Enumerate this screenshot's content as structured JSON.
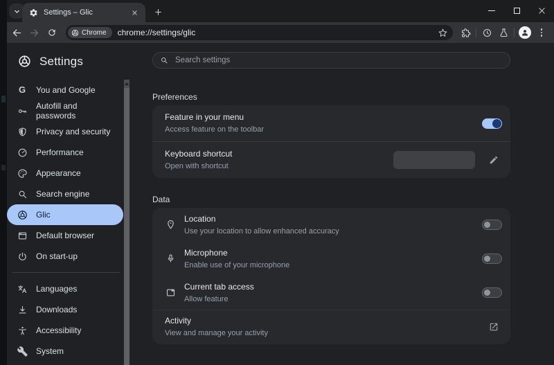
{
  "browser": {
    "tab": {
      "title": "Settings – Glic",
      "favicon": "gear-icon"
    },
    "toolbar_icons": [
      "back-icon",
      "forward-icon",
      "reload-icon",
      "star-icon",
      "extensions-puzzle-icon",
      "history-icon",
      "labs-beaker-icon",
      "profile-avatar",
      "kebab-menu-icon"
    ],
    "window_controls": [
      "minimize",
      "maximize",
      "close"
    ],
    "address": {
      "chip_label": "Chrome",
      "chip_icon": "chrome-logo",
      "url": "chrome://settings/glic"
    }
  },
  "sidebar": {
    "title": "Settings",
    "logo_icon": "chrome-logo",
    "items": [
      {
        "label": "You and Google",
        "icon": "google-g-icon",
        "glyph": "G",
        "selected": false
      },
      {
        "label": "Autofill and passwords",
        "icon": "key-icon",
        "selected": false
      },
      {
        "label": "Privacy and security",
        "icon": "shield-icon",
        "selected": false
      },
      {
        "label": "Performance",
        "icon": "speedometer-icon",
        "selected": false
      },
      {
        "label": "Appearance",
        "icon": "palette-icon",
        "selected": false
      },
      {
        "label": "Search engine",
        "icon": "magnifier-icon",
        "selected": false
      },
      {
        "label": "Glic",
        "icon": "chrome-logo-icon",
        "selected": true
      },
      {
        "label": "Default browser",
        "icon": "browser-window-icon",
        "selected": false
      },
      {
        "label": "On start-up",
        "icon": "power-icon",
        "selected": false
      },
      {
        "label": "Languages",
        "icon": "translate-icon",
        "selected": false
      },
      {
        "label": "Downloads",
        "icon": "download-icon",
        "selected": false
      },
      {
        "label": "Accessibility",
        "icon": "accessibility-person-icon",
        "selected": false
      },
      {
        "label": "System",
        "icon": "wrench-icon",
        "selected": false
      }
    ]
  },
  "search": {
    "placeholder": "Search settings",
    "icon": "magnifier-icon"
  },
  "sections": {
    "preferences": {
      "label": "Preferences",
      "rows": [
        {
          "title": "Feature in your menu",
          "subtitle": "Access feature on the toolbar",
          "control": "toggle",
          "state": "on"
        },
        {
          "title": "Keyboard shortcut",
          "subtitle": "Open with shortcut",
          "control": "shortcut-input",
          "value": "",
          "edit_icon": "pencil-icon"
        }
      ]
    },
    "data": {
      "label": "Data",
      "rows": [
        {
          "icon": "location-pin-icon",
          "title": "Location",
          "subtitle": "Use your location to allow enhanced accuracy",
          "control": "toggle",
          "state": "off"
        },
        {
          "icon": "microphone-icon",
          "title": "Microphone",
          "subtitle": "Enable use of your microphone",
          "control": "toggle",
          "state": "off"
        },
        {
          "icon": "browser-tab-icon",
          "title": "Current tab access",
          "subtitle": "Allow feature",
          "control": "toggle",
          "state": "off"
        },
        {
          "title": "Activity",
          "subtitle": "View and manage your activity",
          "control": "external-link",
          "icon_right": "open-in-new-icon"
        }
      ]
    }
  },
  "colors": {
    "toggle_on_track": "#a8c7fa",
    "toggle_on_knob": "#1a3a74",
    "selected_nav_bg": "#a9c7f9",
    "page_bg": "#1f2124",
    "card_bg": "#28292d",
    "toolbar_bg": "#323438",
    "frame_bg": "#1c1d1f"
  }
}
